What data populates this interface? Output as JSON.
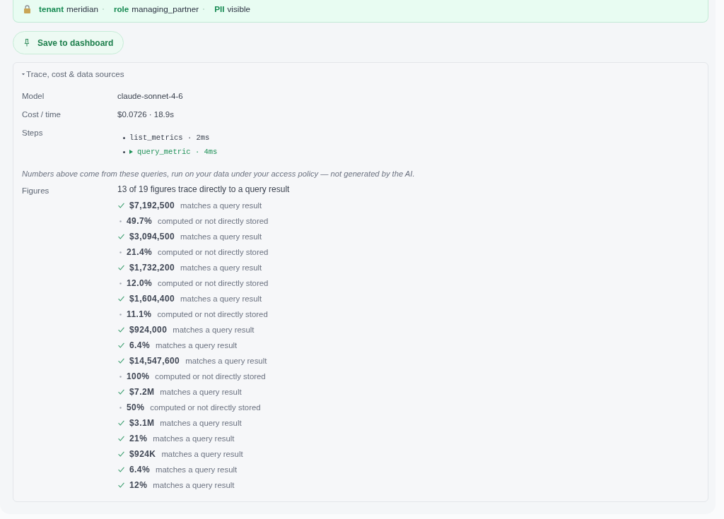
{
  "context_bar": {
    "items": [
      {
        "key": "tenant",
        "value": "meridian"
      },
      {
        "key": "role",
        "value": "managing_partner"
      },
      {
        "key": "PII",
        "value": "visible"
      }
    ]
  },
  "save_button": {
    "label": "Save to dashboard"
  },
  "trace_panel": {
    "summary": "Trace, cost & data sources",
    "expanded": true,
    "fields": [
      {
        "label": "Model",
        "value": "claude-sonnet-4-6"
      },
      {
        "label": "Cost / time",
        "value": "$0.0726 · 18.9s"
      }
    ],
    "steps": {
      "label": "Steps",
      "items": [
        {
          "text": "list_metrics · 2ms",
          "expandable": false
        },
        {
          "text": "query_metric · 4ms",
          "expandable": true
        }
      ]
    },
    "note": "Numbers above come from these queries, run on your data under your access policy — not generated by the AI.",
    "figures": {
      "label": "Figures",
      "summary": "13 of 19 figures trace directly to a query result",
      "items": [
        {
          "value": "$7,192,500",
          "matched": true,
          "note": "matches a query result"
        },
        {
          "value": "49.7%",
          "matched": false,
          "note": "computed or not directly stored"
        },
        {
          "value": "$3,094,500",
          "matched": true,
          "note": "matches a query result"
        },
        {
          "value": "21.4%",
          "matched": false,
          "note": "computed or not directly stored"
        },
        {
          "value": "$1,732,200",
          "matched": true,
          "note": "matches a query result"
        },
        {
          "value": "12.0%",
          "matched": false,
          "note": "computed or not directly stored"
        },
        {
          "value": "$1,604,400",
          "matched": true,
          "note": "matches a query result"
        },
        {
          "value": "11.1%",
          "matched": false,
          "note": "computed or not directly stored"
        },
        {
          "value": "$924,000",
          "matched": true,
          "note": "matches a query result"
        },
        {
          "value": "6.4%",
          "matched": true,
          "note": "matches a query result"
        },
        {
          "value": "$14,547,600",
          "matched": true,
          "note": "matches a query result"
        },
        {
          "value": "100%",
          "matched": false,
          "note": "computed or not directly stored"
        },
        {
          "value": "$7.2M",
          "matched": true,
          "note": "matches a query result"
        },
        {
          "value": "50%",
          "matched": false,
          "note": "computed or not directly stored"
        },
        {
          "value": "$3.1M",
          "matched": true,
          "note": "matches a query result"
        },
        {
          "value": "21%",
          "matched": true,
          "note": "matches a query result"
        },
        {
          "value": "$924K",
          "matched": true,
          "note": "matches a query result"
        },
        {
          "value": "6.4%",
          "matched": true,
          "note": "matches a query result"
        },
        {
          "value": "12%",
          "matched": true,
          "note": "matches a query result"
        }
      ]
    }
  }
}
